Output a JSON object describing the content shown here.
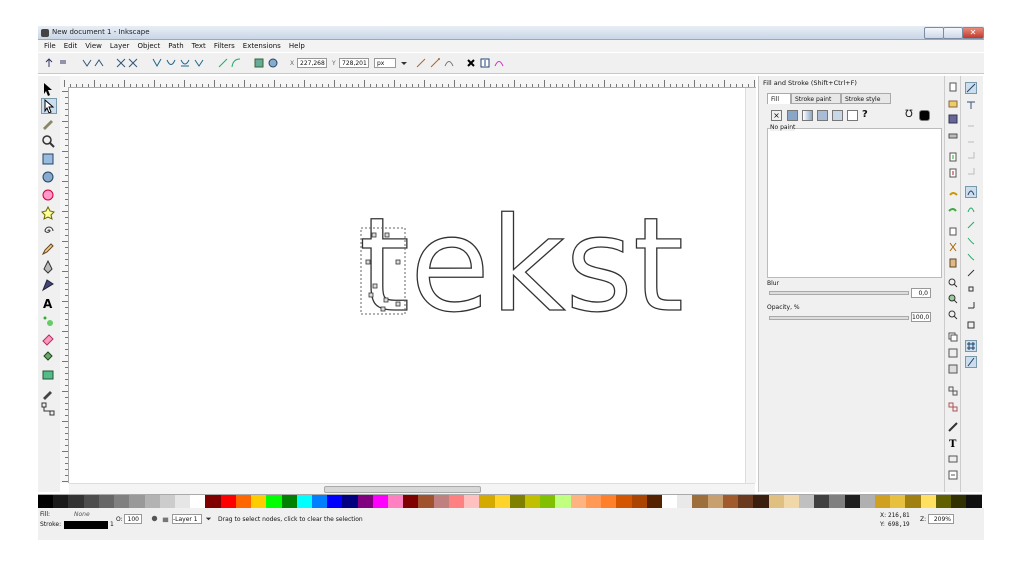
{
  "window": {
    "title": "New document 1 - Inkscape"
  },
  "menu": [
    "File",
    "Edit",
    "View",
    "Layer",
    "Object",
    "Path",
    "Text",
    "Filters",
    "Extensions",
    "Help"
  ],
  "toolbar": {
    "x_label": "X",
    "x_value": "227,268",
    "y_label": "Y",
    "y_value": "728,201",
    "unit": "px"
  },
  "canvas": {
    "text": "tekst"
  },
  "dock": {
    "title": "Fill and Stroke (Shift+Ctrl+F)",
    "tabs": [
      "Fill",
      "Stroke paint",
      "Stroke style"
    ],
    "paint_state": "No paint",
    "blur_label": "Blur",
    "blur_value": "0,0",
    "opacity_label": "Opacity, %",
    "opacity_value": "100,0"
  },
  "status": {
    "fill_label": "Fill:",
    "fill_value": "None",
    "stroke_label": "Stroke:",
    "stroke_width": "1",
    "opacity_label": "O:",
    "opacity_value": "100",
    "layer": "-Layer 1",
    "message": "Drag to select nodes, click to clear the selection",
    "x_label": "X:",
    "x_value": "216,81",
    "y_label": "Y:",
    "y_value": "698,19",
    "zoom_label": "Z:",
    "zoom_value": "209%"
  },
  "palette_colors": [
    "#000000",
    "#1a1a1a",
    "#333333",
    "#4d4d4d",
    "#666666",
    "#808080",
    "#999999",
    "#b3b3b3",
    "#cccccc",
    "#e6e6e6",
    "#ffffff",
    "#800000",
    "#ff0000",
    "#ff6600",
    "#ffcc00",
    "#00ff00",
    "#008000",
    "#00ffff",
    "#0080ff",
    "#0000ff",
    "#000080",
    "#800080",
    "#ff00ff",
    "#ff80c0",
    "#800000",
    "#a0522d",
    "#c08080",
    "#ff8080",
    "#ffc0c0",
    "#d4aa00",
    "#ffd42a",
    "#808000",
    "#c0c000",
    "#80c000",
    "#c0ff80",
    "#ffb380",
    "#ff9955",
    "#ff7f2a",
    "#d45500",
    "#aa4400",
    "#552200",
    "#ffffff",
    "#e9e9e9",
    "#9c6f3b",
    "#c8a070",
    "#a05a2c",
    "#6b3a1e",
    "#3a1f0f",
    "#e0c080",
    "#f0d8a8",
    "#c0c0c0",
    "#404040",
    "#808080",
    "#202020",
    "#b0b0b0",
    "#d0a020",
    "#e8c040",
    "#a08010",
    "#ffe060",
    "#606000",
    "#303000",
    "#101010"
  ]
}
